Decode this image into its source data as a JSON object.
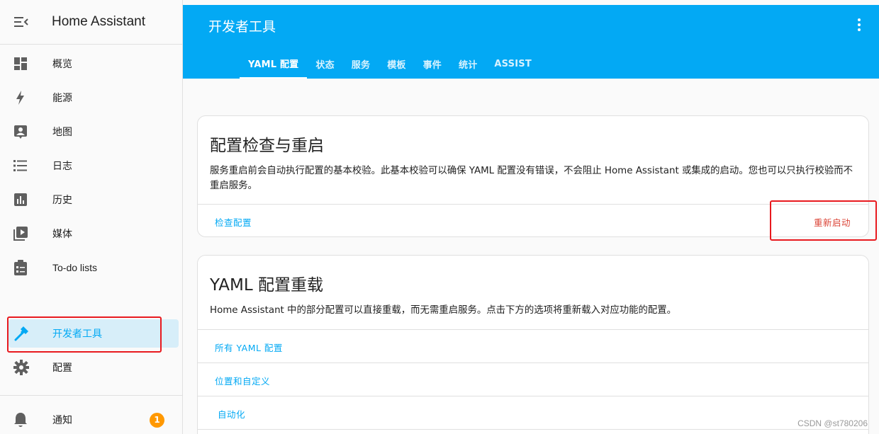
{
  "sidebar": {
    "title": "Home Assistant",
    "items": [
      {
        "label": "概览",
        "icon": "dashboard-icon"
      },
      {
        "label": "能源",
        "icon": "lightning-icon"
      },
      {
        "label": "地图",
        "icon": "map-account-icon"
      },
      {
        "label": "日志",
        "icon": "list-icon"
      },
      {
        "label": "历史",
        "icon": "chart-bar-icon"
      },
      {
        "label": "媒体",
        "icon": "media-play-icon"
      },
      {
        "label": "To-do lists",
        "icon": "clipboard-list-icon"
      }
    ],
    "dev_tools": {
      "label": "开发者工具",
      "icon": "hammer-icon"
    },
    "settings": {
      "label": "配置",
      "icon": "gear-icon"
    },
    "notifications": {
      "label": "通知",
      "icon": "bell-icon",
      "count": "1"
    }
  },
  "header": {
    "title": "开发者工具",
    "tabs": [
      "YAML 配置",
      "状态",
      "服务",
      "模板",
      "事件",
      "统计",
      "ASSIST"
    ],
    "active_tab": "YAML 配置"
  },
  "card_check": {
    "title": "配置检查与重启",
    "description": "服务重启前会自动执行配置的基本校验。此基本校验可以确保 YAML 配置没有错误，不会阻止 Home Assistant 或集成的启动。您也可以只执行校验而不重启服务。",
    "check_label": "检查配置",
    "restart_label": "重新启动"
  },
  "card_reload": {
    "title": "YAML 配置重载",
    "description": "Home Assistant 中的部分配置可以直接重载，而无需重启服务。点击下方的选项将重新载入对应功能的配置。",
    "options": [
      "所有 YAML 配置",
      "位置和自定义",
      "自动化"
    ]
  },
  "watermark": "CSDN @st780206",
  "colors": {
    "primary": "#03a9f4",
    "danger": "#db4437",
    "badge": "#ff9800",
    "highlight": "#e8191e"
  }
}
